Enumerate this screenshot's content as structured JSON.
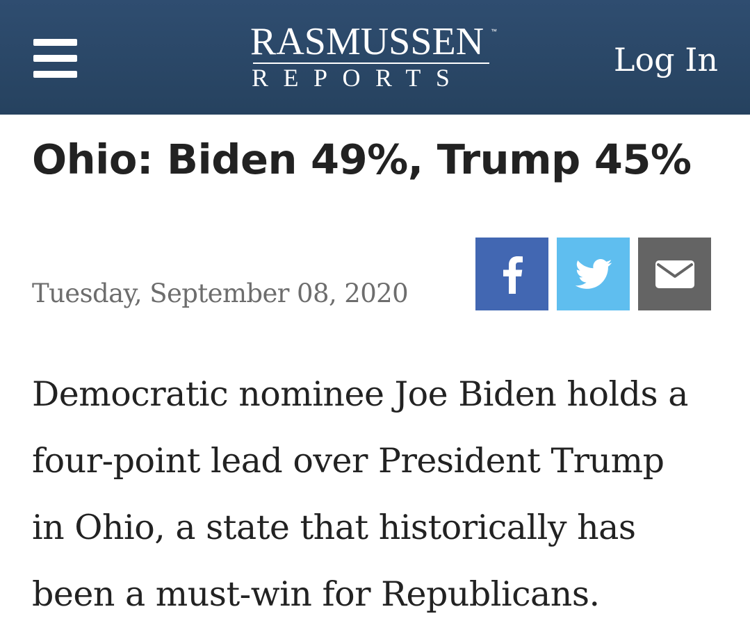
{
  "header": {
    "logo_top": "RASMUSSEN",
    "logo_tm": "™",
    "logo_bottom": "REPORTS",
    "login_label": "Log In",
    "background_color": "#2b4868"
  },
  "article": {
    "headline": "Ohio: Biden 49%, Trump 45%",
    "date": "Tuesday, September 08, 2020",
    "lede_lines": [
      "Democratic nominee Joe Biden holds a",
      "four-point lead over President Trump",
      "in Ohio, a state that historically has",
      "been a must-win for Republicans."
    ]
  },
  "share": {
    "buttons": [
      {
        "icon": "facebook-icon",
        "color": "#4267b2"
      },
      {
        "icon": "twitter-icon",
        "color": "#5fbeef"
      },
      {
        "icon": "email-icon",
        "color": "#646464"
      }
    ]
  },
  "icons": {
    "menu": "hamburger-menu-icon"
  }
}
